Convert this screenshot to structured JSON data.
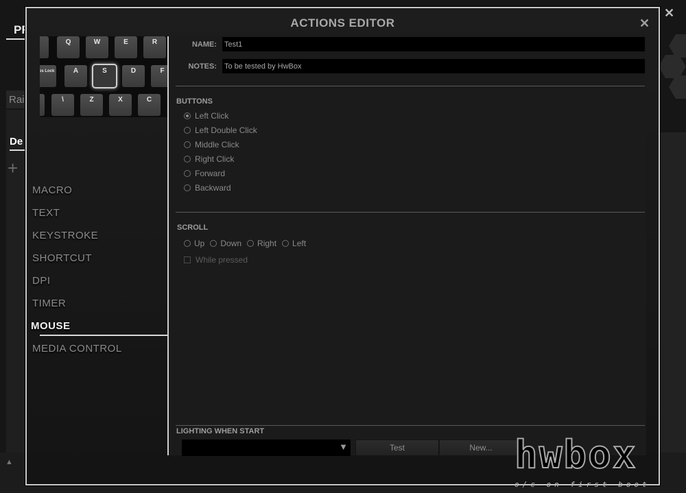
{
  "background_app": {
    "tab_label": "PR",
    "rail_label": "Rai",
    "section_label": "De",
    "add_icon": "plus-icon",
    "close_icon": "close-icon",
    "scroll_up_icon": "triangle-up-icon"
  },
  "dialog": {
    "title": "ACTIONS EDITOR",
    "close_icon": "close-icon",
    "keyboard": {
      "rows": [
        [
          "",
          "Q",
          "W",
          "E",
          "R"
        ],
        [
          "Caps Lock",
          "A",
          "S",
          "D",
          "F"
        ],
        [
          "",
          "\\",
          "Z",
          "X",
          "C"
        ]
      ],
      "selected_key": "S"
    },
    "sidebar": {
      "items": [
        {
          "label": "MACRO",
          "active": false
        },
        {
          "label": "TEXT",
          "active": false
        },
        {
          "label": "KEYSTROKE",
          "active": false
        },
        {
          "label": "SHORTCUT",
          "active": false
        },
        {
          "label": "DPI",
          "active": false
        },
        {
          "label": "TIMER",
          "active": false
        },
        {
          "label": "MOUSE",
          "active": true
        },
        {
          "label": "MEDIA CONTROL",
          "active": false
        }
      ]
    },
    "form": {
      "name_label": "NAME:",
      "name_value": "Test1",
      "notes_label": "NOTES:",
      "notes_value": "To be tested by HwBox"
    },
    "buttons_section": {
      "title": "BUTTONS",
      "options": [
        {
          "label": "Left Click",
          "checked": true
        },
        {
          "label": "Left Double Click",
          "checked": false
        },
        {
          "label": "Middle Click",
          "checked": false
        },
        {
          "label": "Right Click",
          "checked": false
        },
        {
          "label": "Forward",
          "checked": false
        },
        {
          "label": "Backward",
          "checked": false
        }
      ]
    },
    "scroll_section": {
      "title": "SCROLL",
      "options": [
        {
          "label": "Up",
          "checked": false
        },
        {
          "label": "Down",
          "checked": false
        },
        {
          "label": "Right",
          "checked": false
        },
        {
          "label": "Left",
          "checked": false
        }
      ],
      "while_pressed_label": "While pressed",
      "while_pressed_checked": false
    },
    "lighting": {
      "title": "LIGHTING WHEN START",
      "selected_value": "",
      "dropdown_icon": "triangle-down-icon",
      "test_label": "Test",
      "new_label": "New..."
    }
  },
  "watermark": {
    "brand": "hwbox",
    "tagline": "o/c on first boot"
  },
  "colors": {
    "background": "#161616",
    "dialog_border": "#c9c9c9",
    "panel": "#1b1b1b",
    "input_bg": "#000000",
    "text_muted": "#8a8a8a",
    "text_active": "#f2f2f2"
  }
}
